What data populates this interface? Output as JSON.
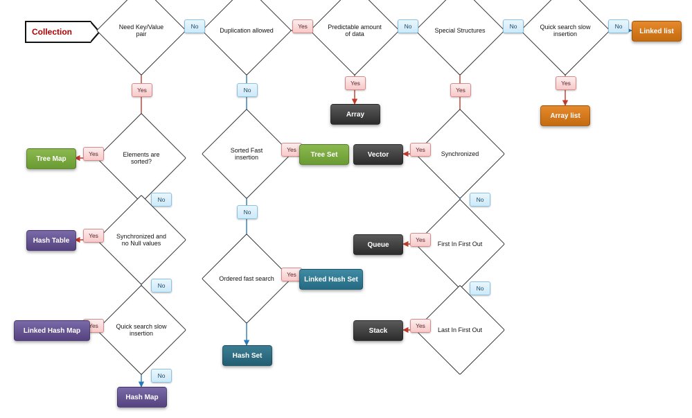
{
  "start": "Collection",
  "decisions": {
    "need_kv": "Need Key/Value pair",
    "dup": "Duplication allowed",
    "pred": "Predictable amount of data",
    "special": "Special Structures",
    "qsearch_r": "Quick search slow insertion",
    "sorted": "Elements are sorted?",
    "sfi": "Sorted Fast insertion",
    "sync_kv": "Synchronized and no Null values",
    "sync_dup": "Synchronized",
    "ordered": "Ordered fast search",
    "qsearch_l": "Quick search slow insertion",
    "fifo": "First In First Out",
    "lifo": "Last In First Out"
  },
  "results": {
    "treemap": "Tree Map",
    "hashtable": "Hash Table",
    "lhm": "Linked Hash Map",
    "hashmap": "Hash Map",
    "treeset": "Tree Set",
    "lhs": "Linked Hash Set",
    "hashset": "Hash Set",
    "array": "Array",
    "vector": "Vector",
    "queue": "Queue",
    "stack": "Stack",
    "linkedlist": "Linked list",
    "arraylist": "Array list"
  },
  "labels": {
    "yes": "Yes",
    "no": "No"
  }
}
